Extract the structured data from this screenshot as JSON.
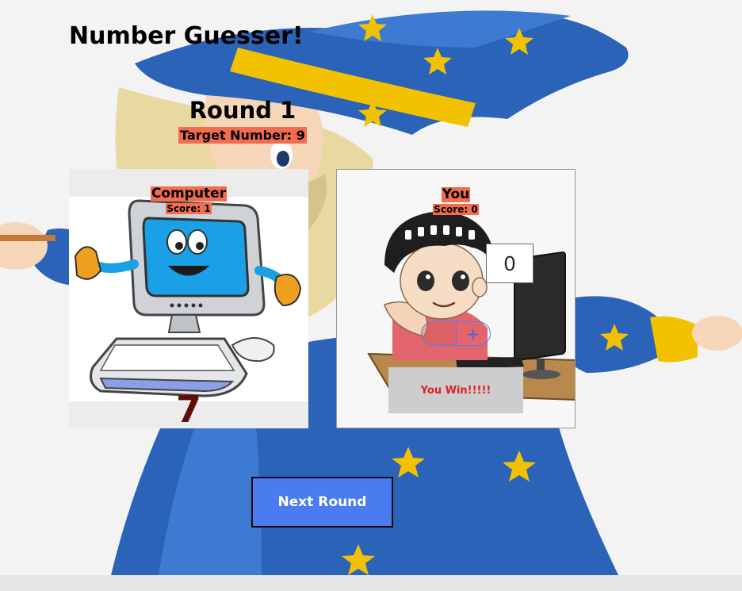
{
  "app": {
    "title": "Number Guesser!"
  },
  "round": {
    "title": "Round 1",
    "target_label": "Target Number: 9"
  },
  "computer": {
    "name": "Computer",
    "score_label": "Score: 1",
    "guess": "7"
  },
  "player": {
    "name": "You",
    "score_label": "Score: 0",
    "guess_value": "0",
    "increment_label": "+",
    "decrement_label": "-",
    "result_text": "You Win!!!!!"
  },
  "actions": {
    "next_round_label": "Next Round"
  },
  "colors": {
    "label_highlight": "#f26c4f",
    "next_button": "#4a7cf0",
    "win_text": "#e02020",
    "computer_guess": "#5e0c0c"
  },
  "icons": [
    "wizard-background",
    "computer-mascot",
    "boy-at-computer"
  ]
}
